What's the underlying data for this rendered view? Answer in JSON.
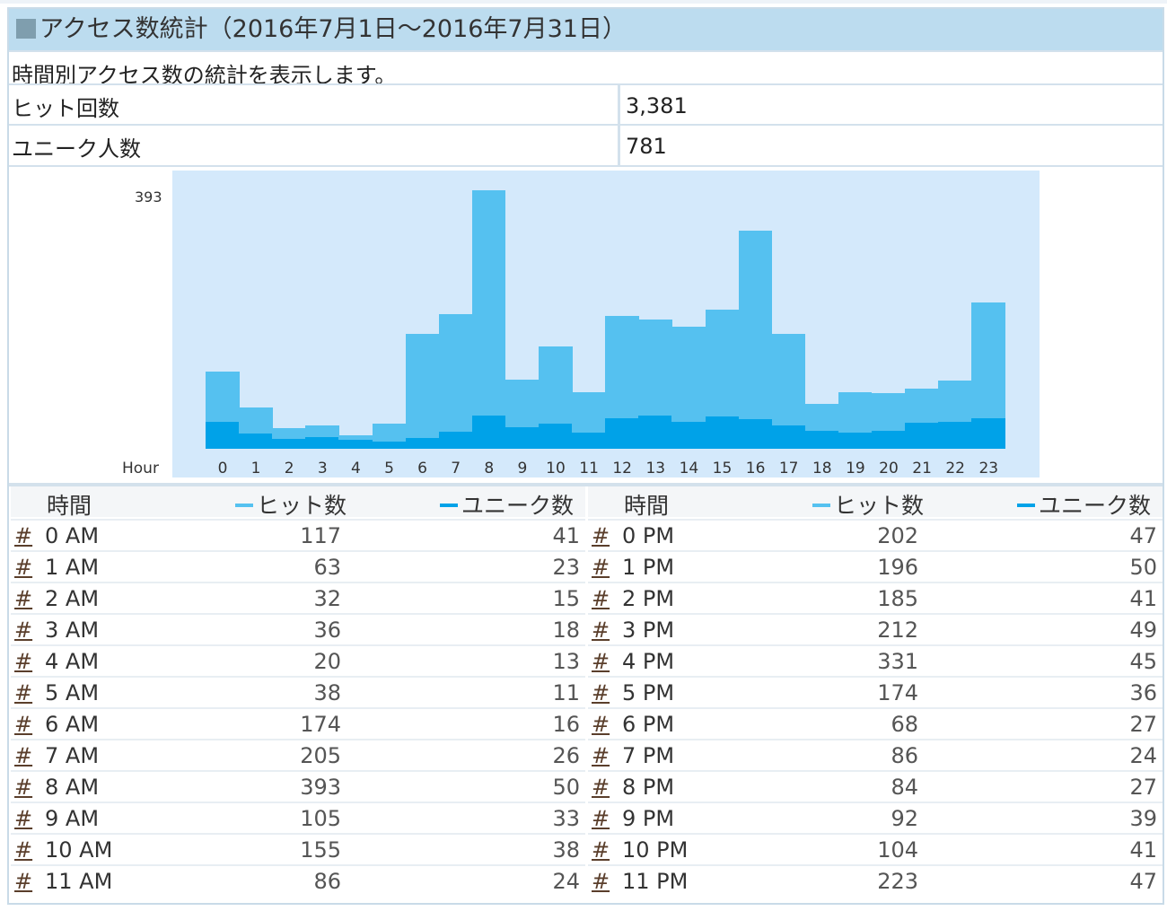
{
  "title": "アクセス数統計（2016年7月1日～2016年7月31日）",
  "description": "時間別アクセス数の統計を表示します。",
  "summary": [
    {
      "label": "ヒット回数",
      "value": "3,381"
    },
    {
      "label": "ユニーク人数",
      "value": "781"
    }
  ],
  "colors": {
    "hits": "#55c1f0",
    "unique": "#00a2e8",
    "header": "#bcdcef",
    "plot_bg": "#d4e9fb"
  },
  "chart_data": {
    "type": "bar",
    "xlabel": "Hour",
    "ymax_label": "393",
    "ylim": [
      0,
      393
    ],
    "categories": [
      "0",
      "1",
      "2",
      "3",
      "4",
      "5",
      "6",
      "7",
      "8",
      "9",
      "10",
      "11",
      "12",
      "13",
      "14",
      "15",
      "16",
      "17",
      "18",
      "19",
      "20",
      "21",
      "22",
      "23"
    ],
    "series": [
      {
        "name": "ヒット数",
        "values": [
          117,
          63,
          32,
          36,
          20,
          38,
          174,
          205,
          393,
          105,
          155,
          86,
          202,
          196,
          185,
          212,
          331,
          174,
          68,
          86,
          84,
          92,
          104,
          223
        ]
      },
      {
        "name": "ユニーク数",
        "values": [
          41,
          23,
          15,
          18,
          13,
          11,
          16,
          26,
          50,
          33,
          38,
          24,
          47,
          50,
          41,
          49,
          45,
          36,
          27,
          24,
          27,
          39,
          41,
          47
        ]
      }
    ]
  },
  "table": {
    "headers": {
      "time": "時間",
      "hits": "ヒット数",
      "unique": "ユニーク数"
    },
    "link": "#",
    "am": [
      "0 AM",
      "1 AM",
      "2 AM",
      "3 AM",
      "4 AM",
      "5 AM",
      "6 AM",
      "7 AM",
      "8 AM",
      "9 AM",
      "10 AM",
      "11 AM"
    ],
    "pm": [
      "0 PM",
      "1 PM",
      "2 PM",
      "3 PM",
      "4 PM",
      "5 PM",
      "6 PM",
      "7 PM",
      "8 PM",
      "9 PM",
      "10 PM",
      "11 PM"
    ]
  }
}
